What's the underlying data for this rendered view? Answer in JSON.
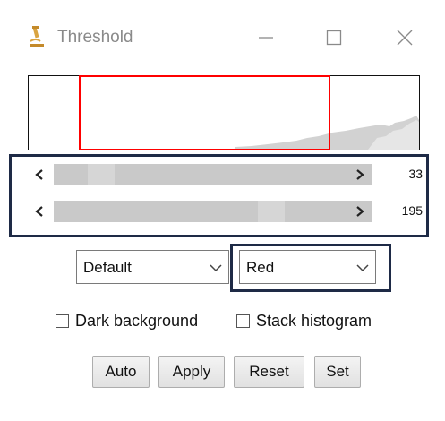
{
  "window": {
    "title": "Threshold",
    "icon": "microscope-icon",
    "controls": [
      "minimize-icon",
      "maximize-icon",
      "close-icon"
    ]
  },
  "histogram": {
    "threshold_color": "#ff0000"
  },
  "sliders": {
    "min": {
      "value": "33"
    },
    "max": {
      "value": "195"
    }
  },
  "dropdowns": {
    "method": {
      "selected": "Default"
    },
    "display": {
      "selected": "Red"
    }
  },
  "checkboxes": {
    "dark_background": {
      "label": "Dark background",
      "checked": false
    },
    "stack_histogram": {
      "label": "Stack histogram",
      "checked": false
    }
  },
  "buttons": {
    "auto": "Auto",
    "apply": "Apply",
    "reset": "Reset",
    "set": "Set"
  },
  "colors": {
    "highlight_frame": "#1e2a46",
    "icon_accent": "#d9a441"
  }
}
